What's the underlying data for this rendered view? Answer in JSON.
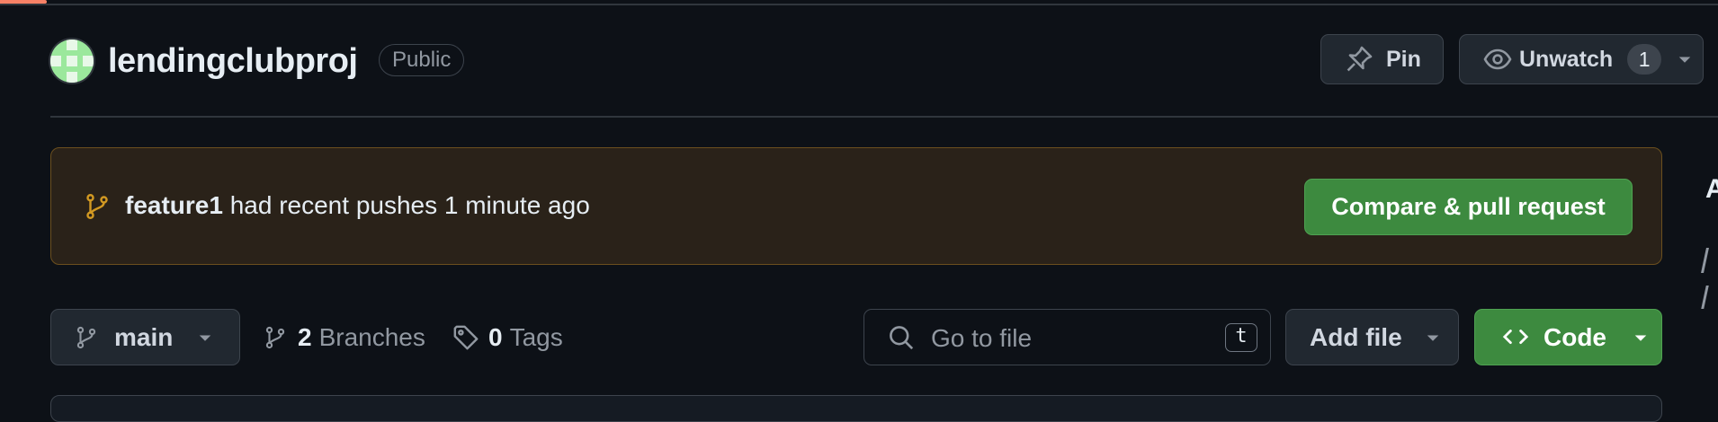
{
  "repo": {
    "name": "lendingclubproj",
    "visibility": "Public"
  },
  "header_actions": {
    "pin_label": "Pin",
    "unwatch_label": "Unwatch",
    "watch_count": "1"
  },
  "banner": {
    "branch": "feature1",
    "message": " had recent pushes 1 minute ago",
    "button_label": "Compare & pull request"
  },
  "toolbar": {
    "branch": "main",
    "branches_count": "2",
    "branches_label": "Branches",
    "tags_count": "0",
    "tags_label": "Tags",
    "search_placeholder": "Go to file",
    "search_shortcut": "t",
    "add_file_label": "Add file",
    "code_label": "Code"
  },
  "sidebar_partial": {
    "heading_initial": "A"
  },
  "colors": {
    "background": "#0d1117",
    "accent_orange": "#f78166",
    "primary_green": "#3d8a3f",
    "banner_bg": "#2a2219",
    "branch_icon_orange": "#d29922"
  },
  "icons": [
    "pin-icon",
    "eye-icon",
    "chevron-down-icon",
    "git-branch-icon",
    "tag-icon",
    "search-icon",
    "code-icon"
  ]
}
